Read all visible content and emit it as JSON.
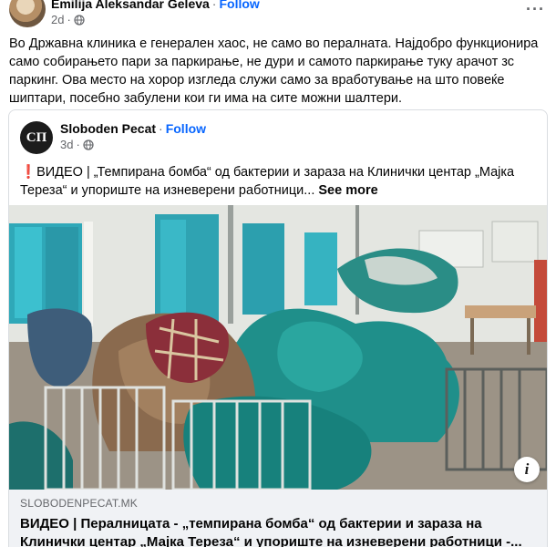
{
  "post": {
    "author": "Emilija Aleksandar Geleva",
    "separator": "·",
    "follow": "Follow",
    "time": "2d",
    "more": "···",
    "text": "Во Државна клиника е генерален хаос, не само во пералната. Најдобро функционира само собирањето пари за паркирање, не дури и самото паркирање туку арачот зс паркинг. Ова место на хорор изгледа служи само за вработување на што повеќе шиптари, посебно забулени кои ги има на сите можни шалтери."
  },
  "shared": {
    "logo_text": "СП",
    "source": "Sloboden Pecat",
    "separator": "·",
    "follow": "Follow",
    "time": "3d",
    "exclamation": "❗",
    "text": "ВИДЕО | „Темпирана бомба“ од бактерии и зараза на Клинички центар „Мајка Тереза“ и упориште на изневерени работници...",
    "see_more": "See more",
    "info": "i",
    "link_domain": "SLOBODENPECAT.MK",
    "link_title": "ВИДЕО | Пералницата - „темпирана бомба“ од бактерии и зараза на Клинички центар „Мајка Тереза“ и упориште на изневерени работници -..."
  },
  "icons": {
    "globe": "globe-icon",
    "more": "more-options-icon",
    "info": "info-icon"
  },
  "colors": {
    "link_blue": "#0866ff",
    "secondary_text": "#65676b",
    "link_box_bg": "#f0f2f5",
    "alert_red": "#e41e3f"
  }
}
